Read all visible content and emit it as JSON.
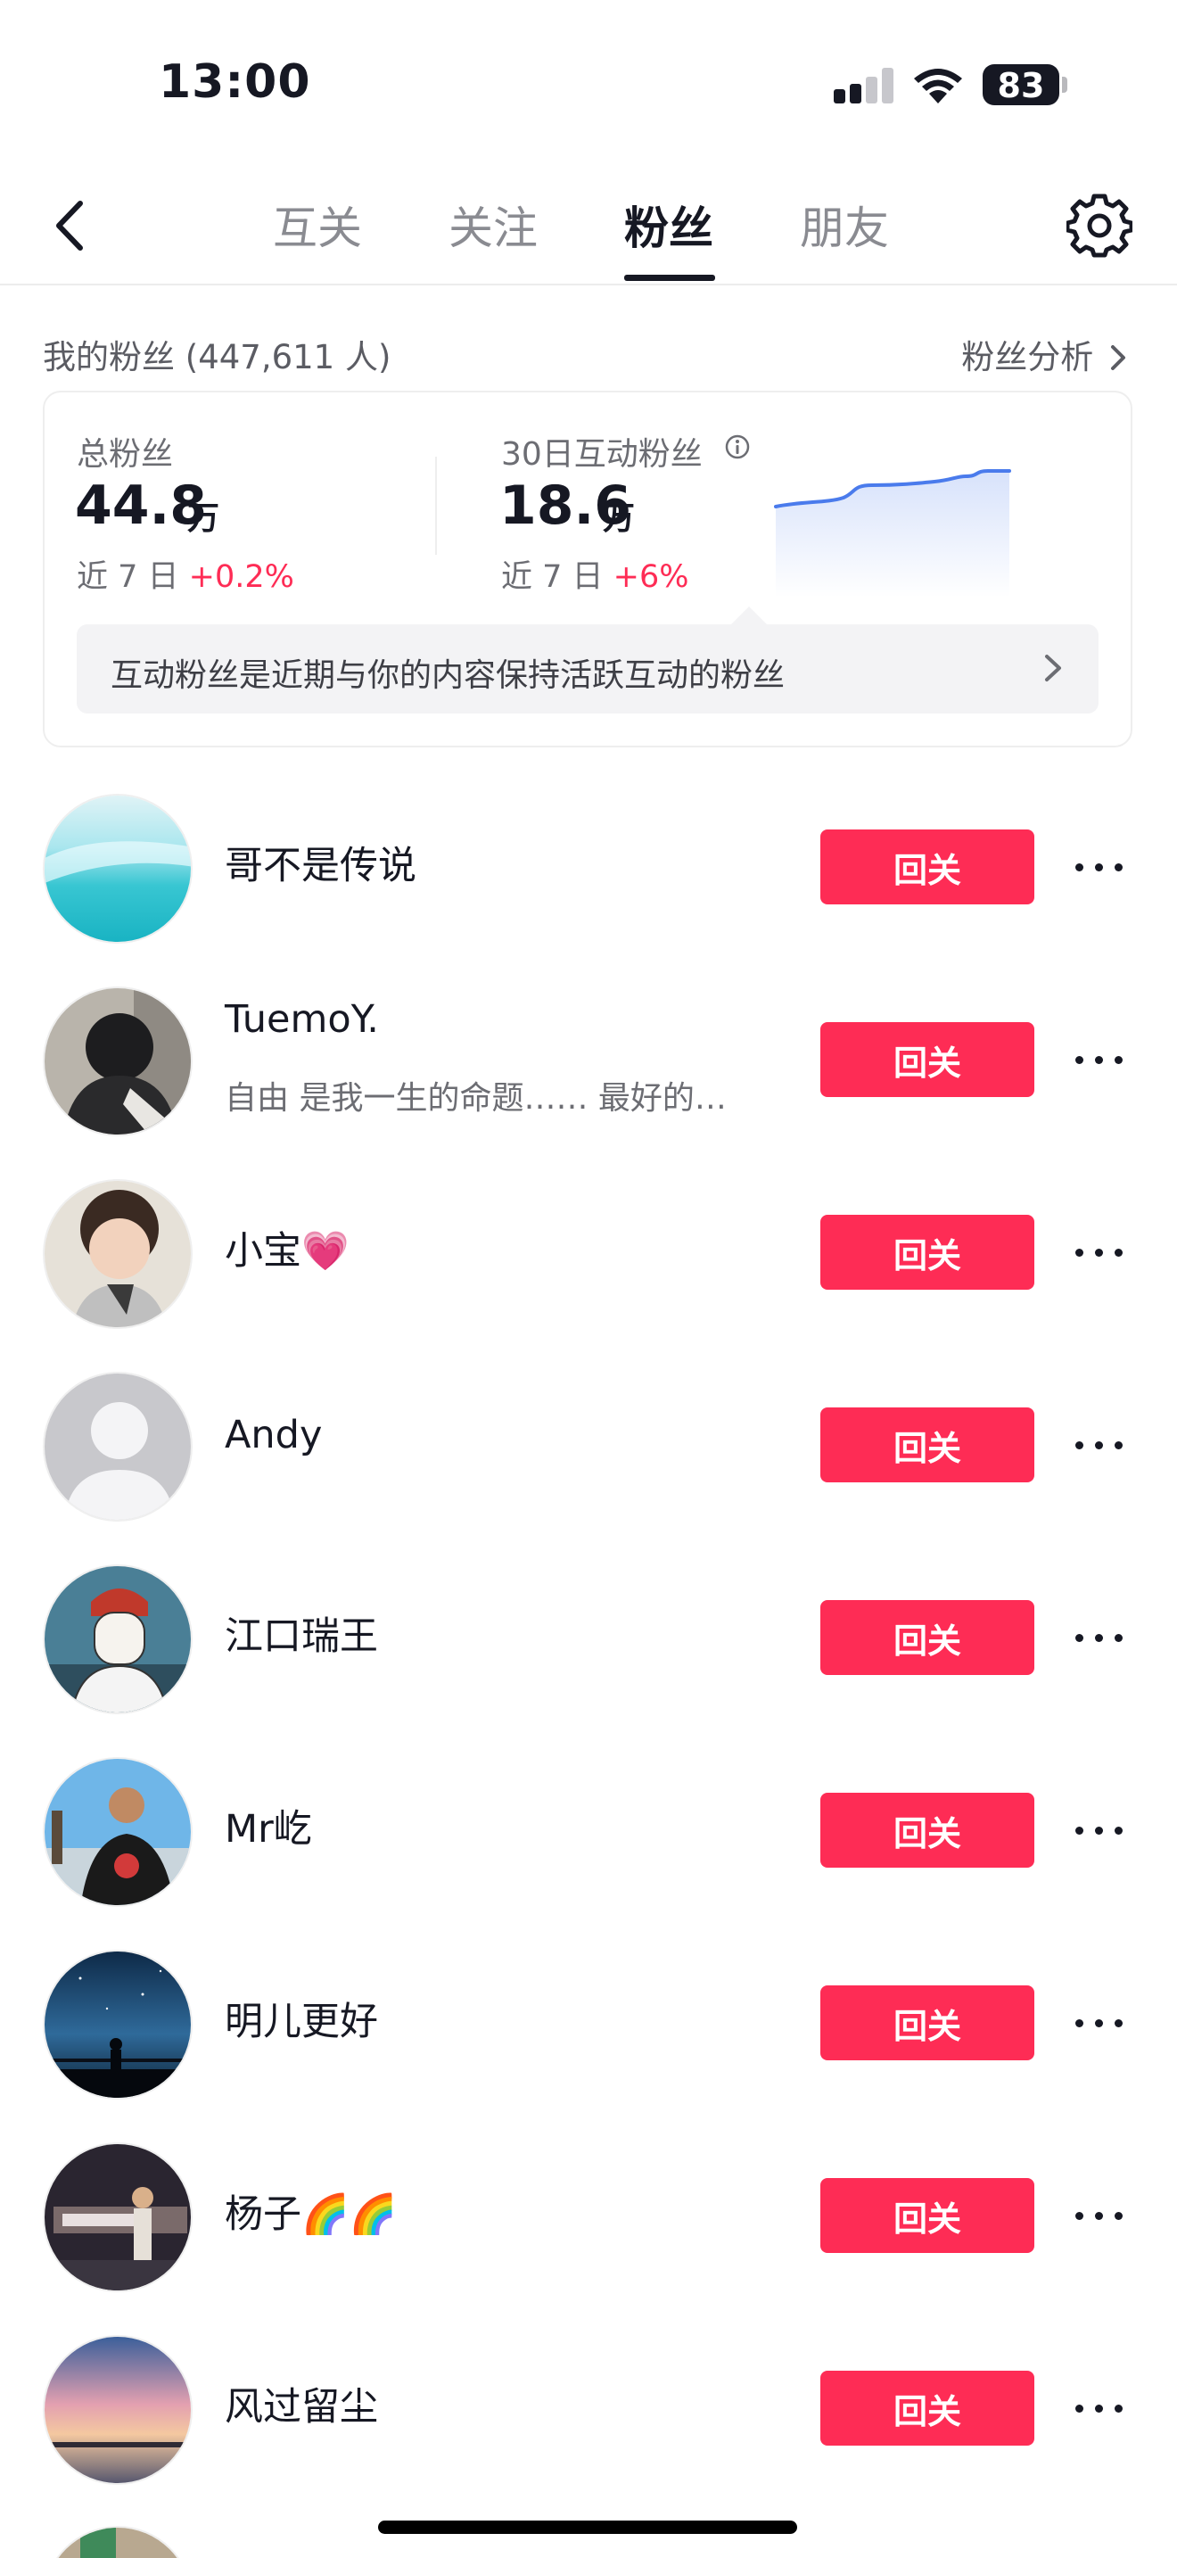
{
  "status_bar": {
    "time": "13:00",
    "battery": "83"
  },
  "nav": {
    "tabs": [
      {
        "label": "互关",
        "active": false
      },
      {
        "label": "关注",
        "active": false
      },
      {
        "label": "粉丝",
        "active": true
      },
      {
        "label": "朋友",
        "active": false
      }
    ]
  },
  "fans_header": {
    "title": "我的粉丝",
    "count": "(447,611 人)",
    "analysis_link": "粉丝分析"
  },
  "stats": {
    "total": {
      "label": "总粉丝",
      "value": "44.8",
      "unit": "万",
      "change_label": "近 7 日",
      "change": "+0.2%"
    },
    "interactive": {
      "label": "30日互动粉丝",
      "value": "18.6",
      "unit": "万",
      "change_label": "近 7 日",
      "change": "+6%"
    },
    "hint": "互动粉丝是近期与你的内容保持活跃互动的粉丝",
    "colors": {
      "accent": "#fe2c55",
      "sparkline": "#4a7bec"
    }
  },
  "fans": [
    {
      "name": "哥不是传说",
      "bio": "",
      "button": "回关"
    },
    {
      "name": "TuemoY.",
      "bio": "自由 是我一生的命题…… 最好的…",
      "button": "回关"
    },
    {
      "name": "小宝💗",
      "bio": "",
      "button": "回关"
    },
    {
      "name": "Andy",
      "bio": "",
      "button": "回关"
    },
    {
      "name": "江口瑞王",
      "bio": "",
      "button": "回关"
    },
    {
      "name": "Mr屹",
      "bio": "",
      "button": "回关"
    },
    {
      "name": "明儿更好",
      "bio": "",
      "button": "回关"
    },
    {
      "name": "杨子🌈🌈",
      "bio": "",
      "button": "回关"
    },
    {
      "name": "风过留尘",
      "bio": "",
      "button": "回关"
    }
  ]
}
